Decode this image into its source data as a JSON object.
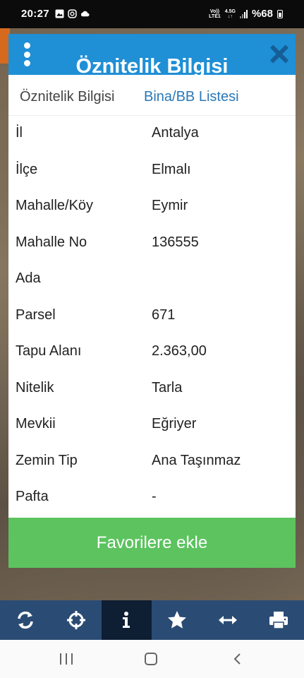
{
  "status_bar": {
    "time": "20:27",
    "network_top": "Vo))",
    "network_bottom": "LTE1",
    "data_top": "4.5G",
    "data_bottom": "↓↑",
    "battery": "%68"
  },
  "modal": {
    "title": "Öznitelik Bilgisi",
    "tabs": [
      {
        "label": "Öznitelik Bilgisi",
        "active": true
      },
      {
        "label": "Bina/BB Listesi",
        "active": false
      }
    ],
    "rows": [
      {
        "key": "İl",
        "value": "Antalya"
      },
      {
        "key": "İlçe",
        "value": "Elmalı"
      },
      {
        "key": "Mahalle/Köy",
        "value": "Eymir"
      },
      {
        "key": "Mahalle No",
        "value": "136555"
      },
      {
        "key": "Ada",
        "value": ""
      },
      {
        "key": "Parsel",
        "value": "671"
      },
      {
        "key": "Tapu Alanı",
        "value": "2.363,00"
      },
      {
        "key": "Nitelik",
        "value": "Tarla"
      },
      {
        "key": "Mevkii",
        "value": "Eğriyer"
      },
      {
        "key": "Zemin Tip",
        "value": "Ana Taşınmaz"
      },
      {
        "key": "Pafta",
        "value": "-"
      }
    ],
    "favorite_button": "Favorilere ekle"
  },
  "toolbar": {
    "items": [
      {
        "icon": "refresh-icon",
        "active": false
      },
      {
        "icon": "crosshair-icon",
        "active": false
      },
      {
        "icon": "info-icon",
        "active": true
      },
      {
        "icon": "star-icon",
        "active": false
      },
      {
        "icon": "measure-arrows-icon",
        "active": false
      },
      {
        "icon": "print-icon",
        "active": false
      }
    ]
  },
  "colors": {
    "header_blue": "#1f8fd6",
    "tab_link": "#2a78b8",
    "favorite_green": "#5cc35f",
    "toolbar_bg": "#2a4c74",
    "toolbar_active": "#0e1e33"
  }
}
